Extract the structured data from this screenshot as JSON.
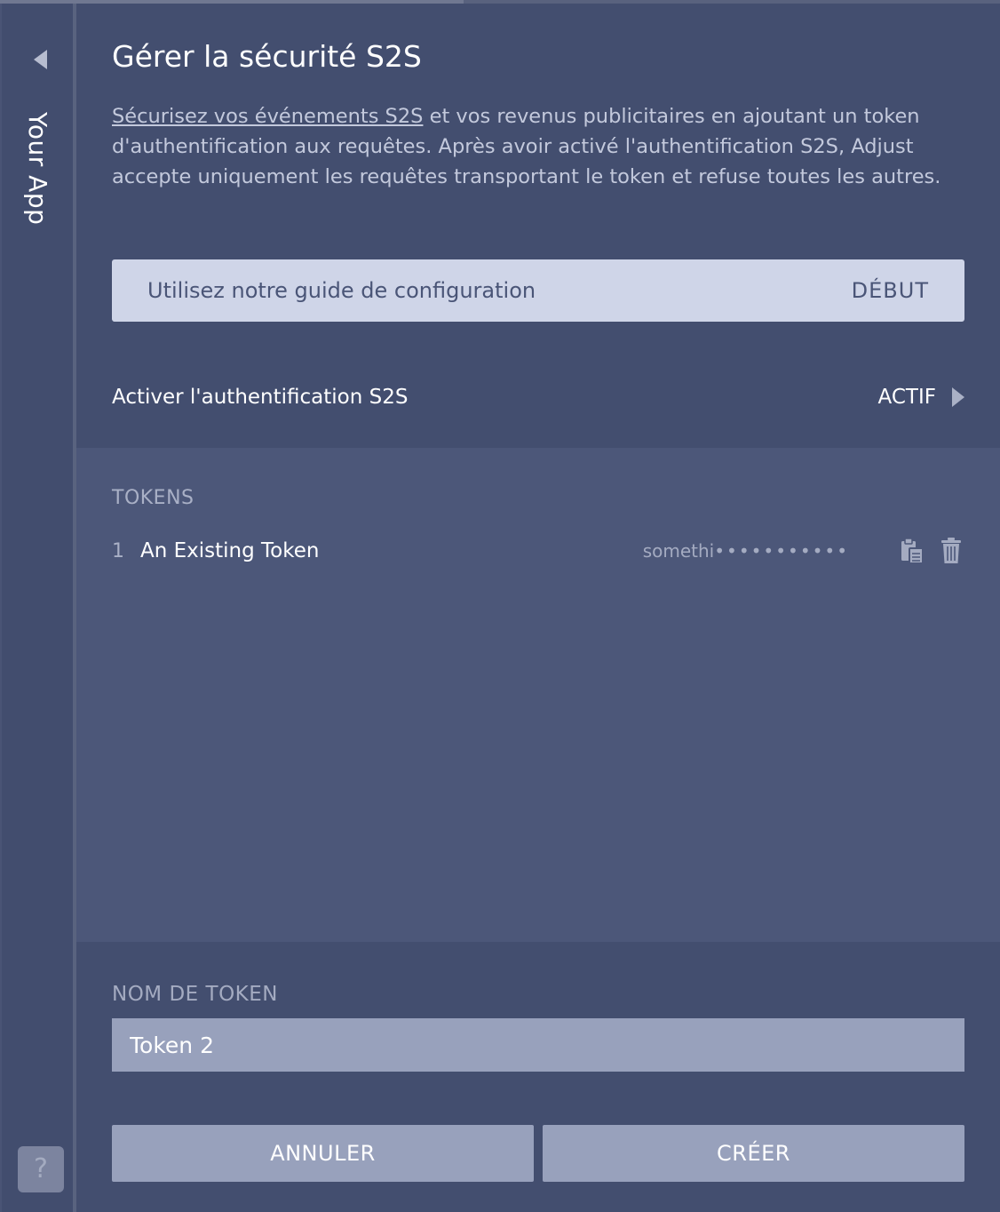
{
  "sidebar": {
    "app_name": "Your App",
    "help_label": "?"
  },
  "page": {
    "title": "Gérer la sécurité S2S",
    "description_link": "Sécurisez vos événements S2S",
    "description_rest": " et vos revenus publicitaires en ajoutant un token d'authentification aux requêtes. Après avoir activé l'authentification S2S, Adjust accepte uniquement les requêtes transportant le token et refuse toutes les autres."
  },
  "guide": {
    "label": "Utilisez notre guide de configuration",
    "action": "DÉBUT"
  },
  "auth": {
    "label": "Activer l'authentification S2S",
    "status": "ACTIF"
  },
  "tokens": {
    "heading": "TOKENS",
    "items": [
      {
        "index": "1",
        "name": "An Existing Token",
        "value_prefix": "somethi",
        "value_mask": "•••••••••••"
      }
    ]
  },
  "form": {
    "field_label": "NOM DE TOKEN",
    "token_name_value": "Token 2",
    "cancel_label": "ANNULER",
    "create_label": "CRÉER"
  },
  "colors": {
    "background": "#434e6f",
    "tokens_panel": "#4c5779",
    "guide_bar": "#cfd5e8",
    "button": "#98a1bc"
  }
}
